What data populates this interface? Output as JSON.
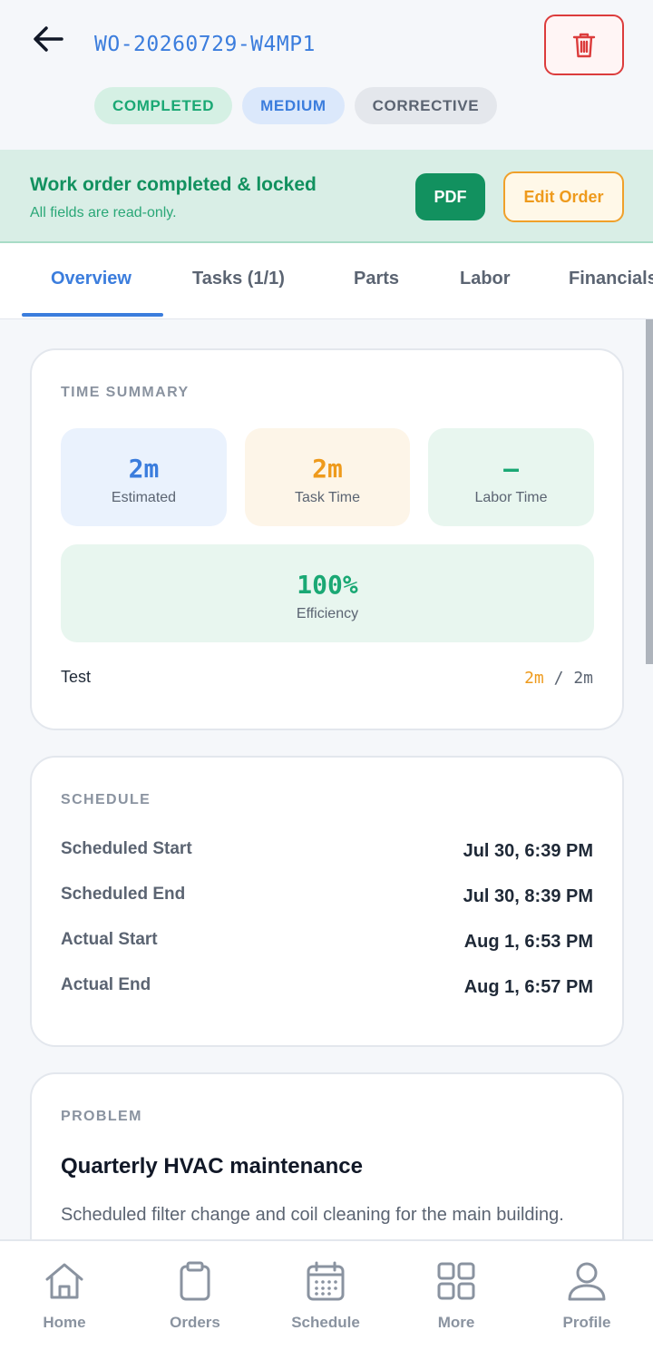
{
  "header": {
    "work_order_id": "WO-20260729-W4MP1",
    "badges": {
      "status": "COMPLETED",
      "priority": "MEDIUM",
      "type": "CORRECTIVE"
    }
  },
  "lock_banner": {
    "title": "Work order completed & locked",
    "subtitle": "All fields are read-only.",
    "pdf_label": "PDF",
    "edit_label": "Edit Order"
  },
  "tabs": [
    {
      "label": "Overview",
      "active": true
    },
    {
      "label": "Tasks (1/1)"
    },
    {
      "label": "Parts"
    },
    {
      "label": "Labor"
    },
    {
      "label": "Financials"
    }
  ],
  "time_summary": {
    "title": "TIME SUMMARY",
    "estimated": {
      "value": "2m",
      "label": "Estimated"
    },
    "task_time": {
      "value": "2m",
      "label": "Task Time"
    },
    "labor_time": {
      "value": "–",
      "label": "Labor Time"
    },
    "efficiency": {
      "value": "100%",
      "label": "Efficiency"
    },
    "task_row": {
      "name": "Test",
      "actual": "2m",
      "separator": "/",
      "estimated": "2m"
    }
  },
  "schedule": {
    "title": "SCHEDULE",
    "rows": [
      {
        "label": "Scheduled Start",
        "value": "Jul 30, 6:39 PM"
      },
      {
        "label": "Scheduled End",
        "value": "Jul 30, 8:39 PM"
      },
      {
        "label": "Actual Start",
        "value": "Aug 1, 6:53 PM"
      },
      {
        "label": "Actual End",
        "value": "Aug 1, 6:57 PM"
      }
    ]
  },
  "problem": {
    "title": "PROBLEM",
    "heading": "Quarterly HVAC maintenance",
    "description": "Scheduled filter change and coil cleaning for the main building."
  },
  "bottom_nav": [
    {
      "label": "Home",
      "icon": "home-icon"
    },
    {
      "label": "Orders",
      "icon": "clipboard-icon"
    },
    {
      "label": "Schedule",
      "icon": "calendar-icon"
    },
    {
      "label": "More",
      "icon": "grid-icon"
    },
    {
      "label": "Profile",
      "icon": "user-icon"
    }
  ],
  "colors": {
    "accent_blue": "#3b7ddd",
    "success_green": "#12915f",
    "warning_orange": "#ee9a1c",
    "danger_red": "#dc3c3c"
  }
}
